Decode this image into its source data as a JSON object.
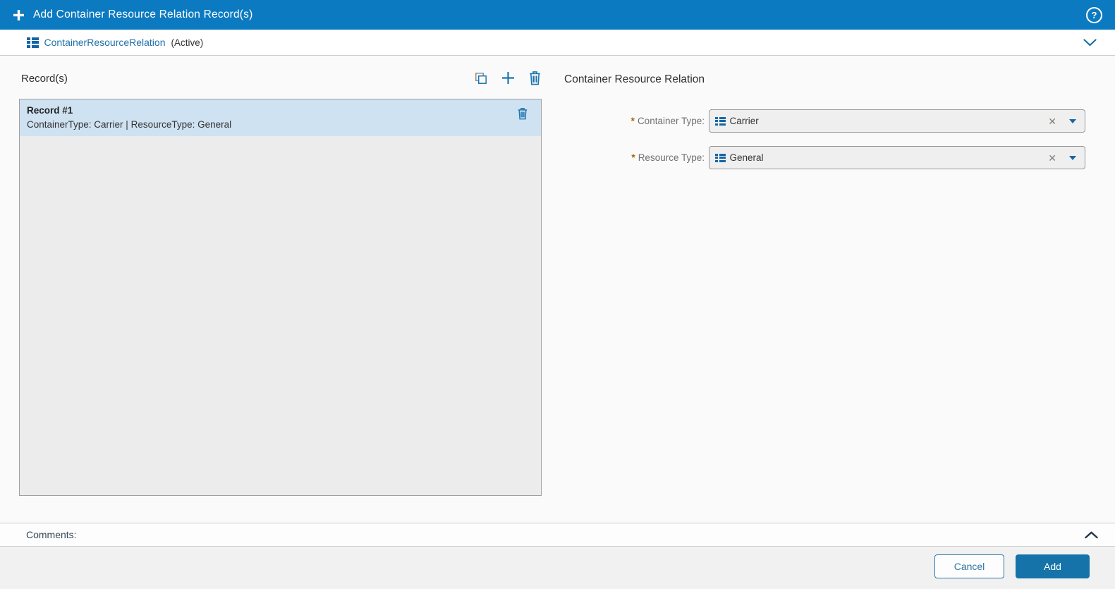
{
  "header": {
    "title": "Add Container Resource Relation Record(s)",
    "help_icon_glyph": "?"
  },
  "subheader": {
    "table_link": "ContainerResourceRelation",
    "status": "(Active)"
  },
  "records_panel": {
    "title": "Record(s)",
    "toolbar": {
      "copy_icon": "copy",
      "add_icon": "plus",
      "delete_icon": "trash"
    },
    "items": [
      {
        "title": "Record #1",
        "summary": "ContainerType: Carrier | ResourceType: General",
        "selected": true
      }
    ]
  },
  "detail_panel": {
    "title": "Container Resource Relation",
    "required_marker": "*",
    "fields": [
      {
        "label": "Container Type:",
        "value": "Carrier",
        "required": true
      },
      {
        "label": "Resource Type:",
        "value": "General",
        "required": true
      }
    ],
    "clear_icon_glyph": "✕"
  },
  "comments": {
    "label": "Comments:"
  },
  "footer": {
    "cancel_label": "Cancel",
    "add_label": "Add"
  },
  "colors": {
    "header_bg": "#0b7ac1",
    "accent_blue": "#1c74af",
    "link_blue": "#1d6fa8",
    "selected_row_bg": "#cfe2f2",
    "list_bg": "#ececec",
    "required_star": "#a86203",
    "add_button_bg": "#1573a9",
    "footer_bg": "#f1f1f1"
  }
}
